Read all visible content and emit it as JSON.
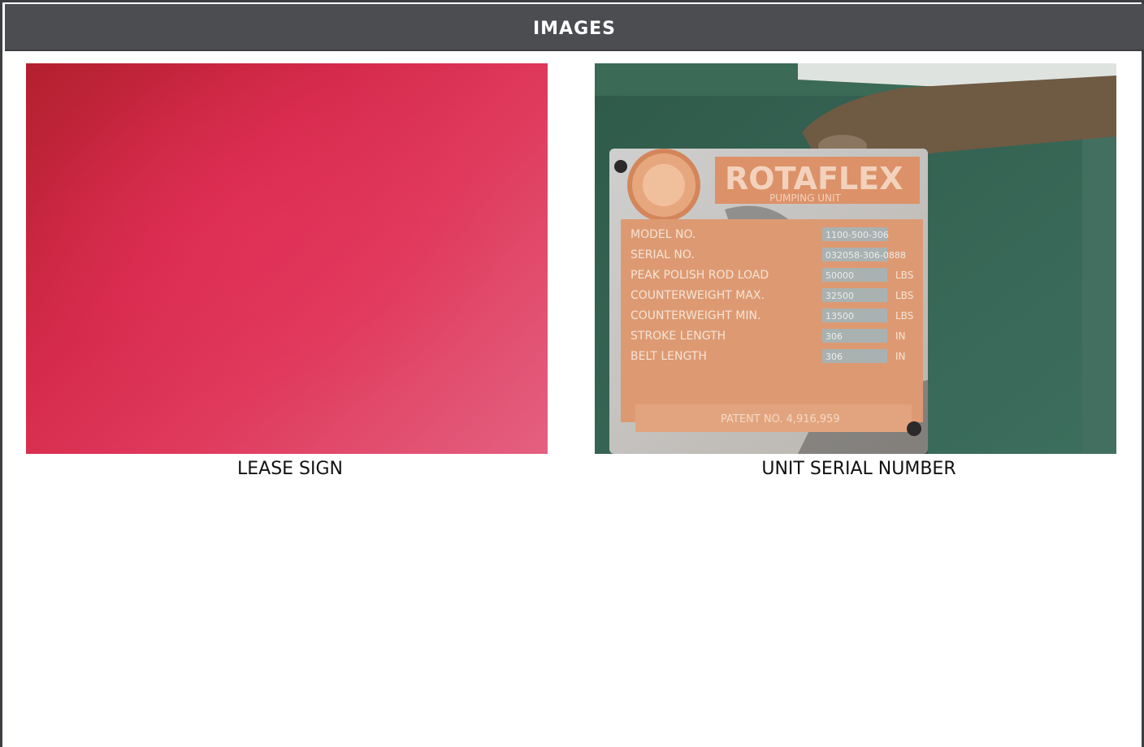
{
  "header": {
    "title": "IMAGES"
  },
  "images": [
    {
      "caption": "LEASE SIGN",
      "photo_color": "#d62a4c"
    },
    {
      "caption": "UNIT SERIAL NUMBER",
      "plate": {
        "brand": "ROTAFLEX",
        "subtitle": "PUMPING UNIT",
        "rows": [
          {
            "label": "MODEL NO.",
            "value": "1100-500-306",
            "unit": ""
          },
          {
            "label": "SERIAL NO.",
            "value": "032058-306-0888",
            "unit": ""
          },
          {
            "label": "PEAK POLISH ROD LOAD",
            "value": "50000",
            "unit": "LBS"
          },
          {
            "label": "COUNTERWEIGHT MAX.",
            "value": "32500",
            "unit": "LBS"
          },
          {
            "label": "COUNTERWEIGHT MIN.",
            "value": "13500",
            "unit": "LBS"
          },
          {
            "label": "STROKE LENGTH",
            "value": "306",
            "unit": "IN"
          },
          {
            "label": "BELT LENGTH",
            "value": "306",
            "unit": "IN"
          }
        ],
        "patent": "PATENT NO. 4,916,959"
      }
    }
  ]
}
